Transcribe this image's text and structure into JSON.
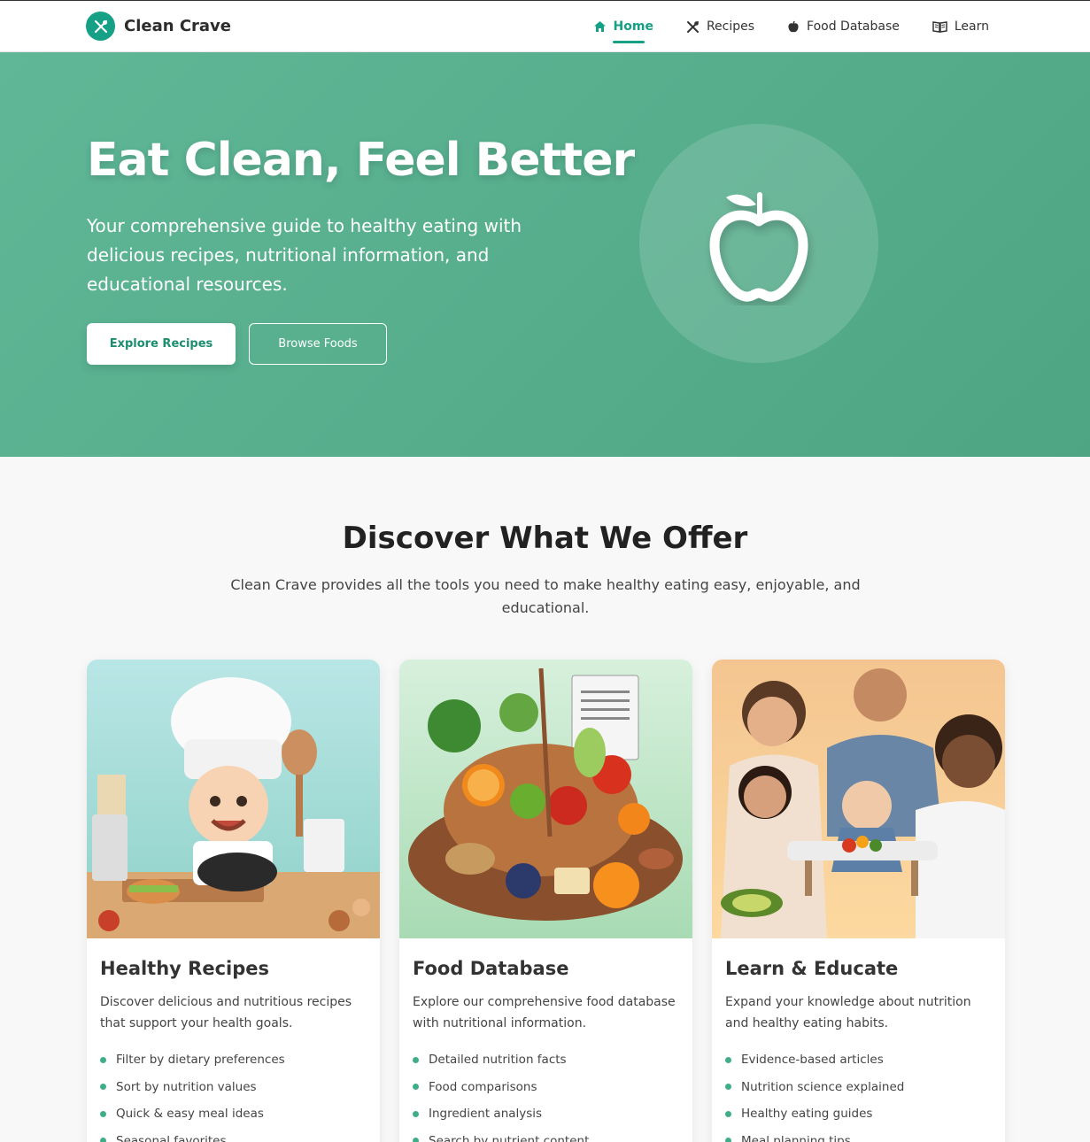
{
  "nav": {
    "brand": "Clean Crave",
    "items": [
      {
        "label": "Home",
        "icon": "home-icon",
        "active": true
      },
      {
        "label": "Recipes",
        "icon": "utensils-icon",
        "active": false
      },
      {
        "label": "Food Database",
        "icon": "apple-icon",
        "active": false
      },
      {
        "label": "Learn",
        "icon": "book-icon",
        "active": false
      }
    ]
  },
  "hero": {
    "title": "Eat Clean, Feel Better",
    "subtitle": "Your comprehensive guide to healthy eating with delicious recipes, nutritional information, and educational resources.",
    "primary_button": "Explore Recipes",
    "secondary_button": "Browse Foods"
  },
  "offer": {
    "title": "Discover What We Offer",
    "subtitle": "Clean Crave provides all the tools you need to make healthy eating easy, enjoyable, and educational."
  },
  "cards": [
    {
      "title": "Healthy Recipes",
      "description": "Discover delicious and nutritious recipes that support your health goals.",
      "features": [
        "Filter by dietary preferences",
        "Sort by nutrition values",
        "Quick & easy meal ideas",
        "Seasonal favorites"
      ]
    },
    {
      "title": "Food Database",
      "description": "Explore our comprehensive food database with nutritional information.",
      "features": [
        "Detailed nutrition facts",
        "Food comparisons",
        "Ingredient analysis",
        "Search by nutrient content"
      ]
    },
    {
      "title": "Learn & Educate",
      "description": "Expand your knowledge about nutrition and healthy eating habits.",
      "features": [
        "Evidence-based articles",
        "Nutrition science explained",
        "Healthy eating guides",
        "Meal planning tips"
      ]
    }
  ],
  "colors": {
    "brand": "#16a085",
    "hero": "#55ae8c",
    "bullet": "#3fae86"
  }
}
